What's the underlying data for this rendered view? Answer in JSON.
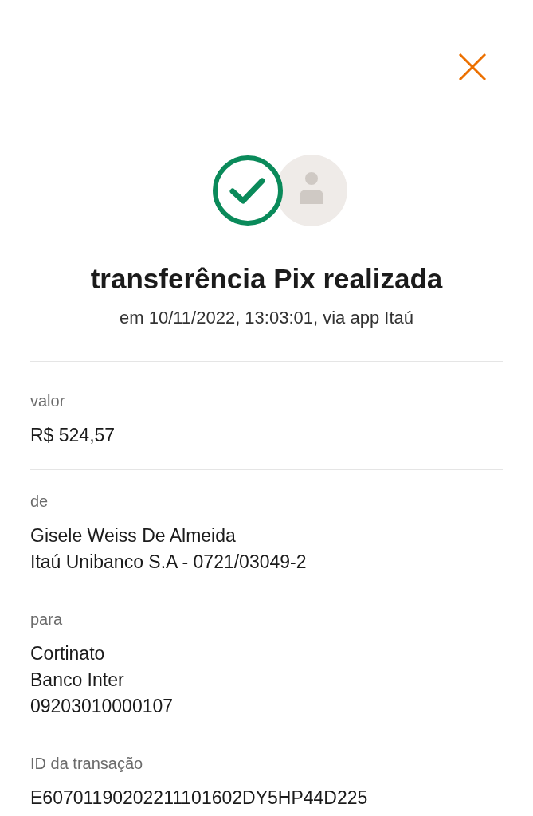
{
  "title": "transferência Pix realizada",
  "subtitle": "em 10/11/2022, 13:03:01, via app Itaú",
  "sections": [
    {
      "label": "valor",
      "lines": [
        "R$ 524,57"
      ],
      "divided": true
    },
    {
      "label": "de",
      "lines": [
        "Gisele Weiss De Almeida",
        "Itaú Unibanco S.A - 0721/03049-2"
      ],
      "divided": false
    },
    {
      "label": "para",
      "lines": [
        "Cortinato",
        "Banco Inter",
        "09203010000107"
      ],
      "divided": false
    },
    {
      "label": "ID da transação",
      "lines": [
        "E60701190202211101602DY5HP44D225"
      ],
      "divided": false
    }
  ]
}
